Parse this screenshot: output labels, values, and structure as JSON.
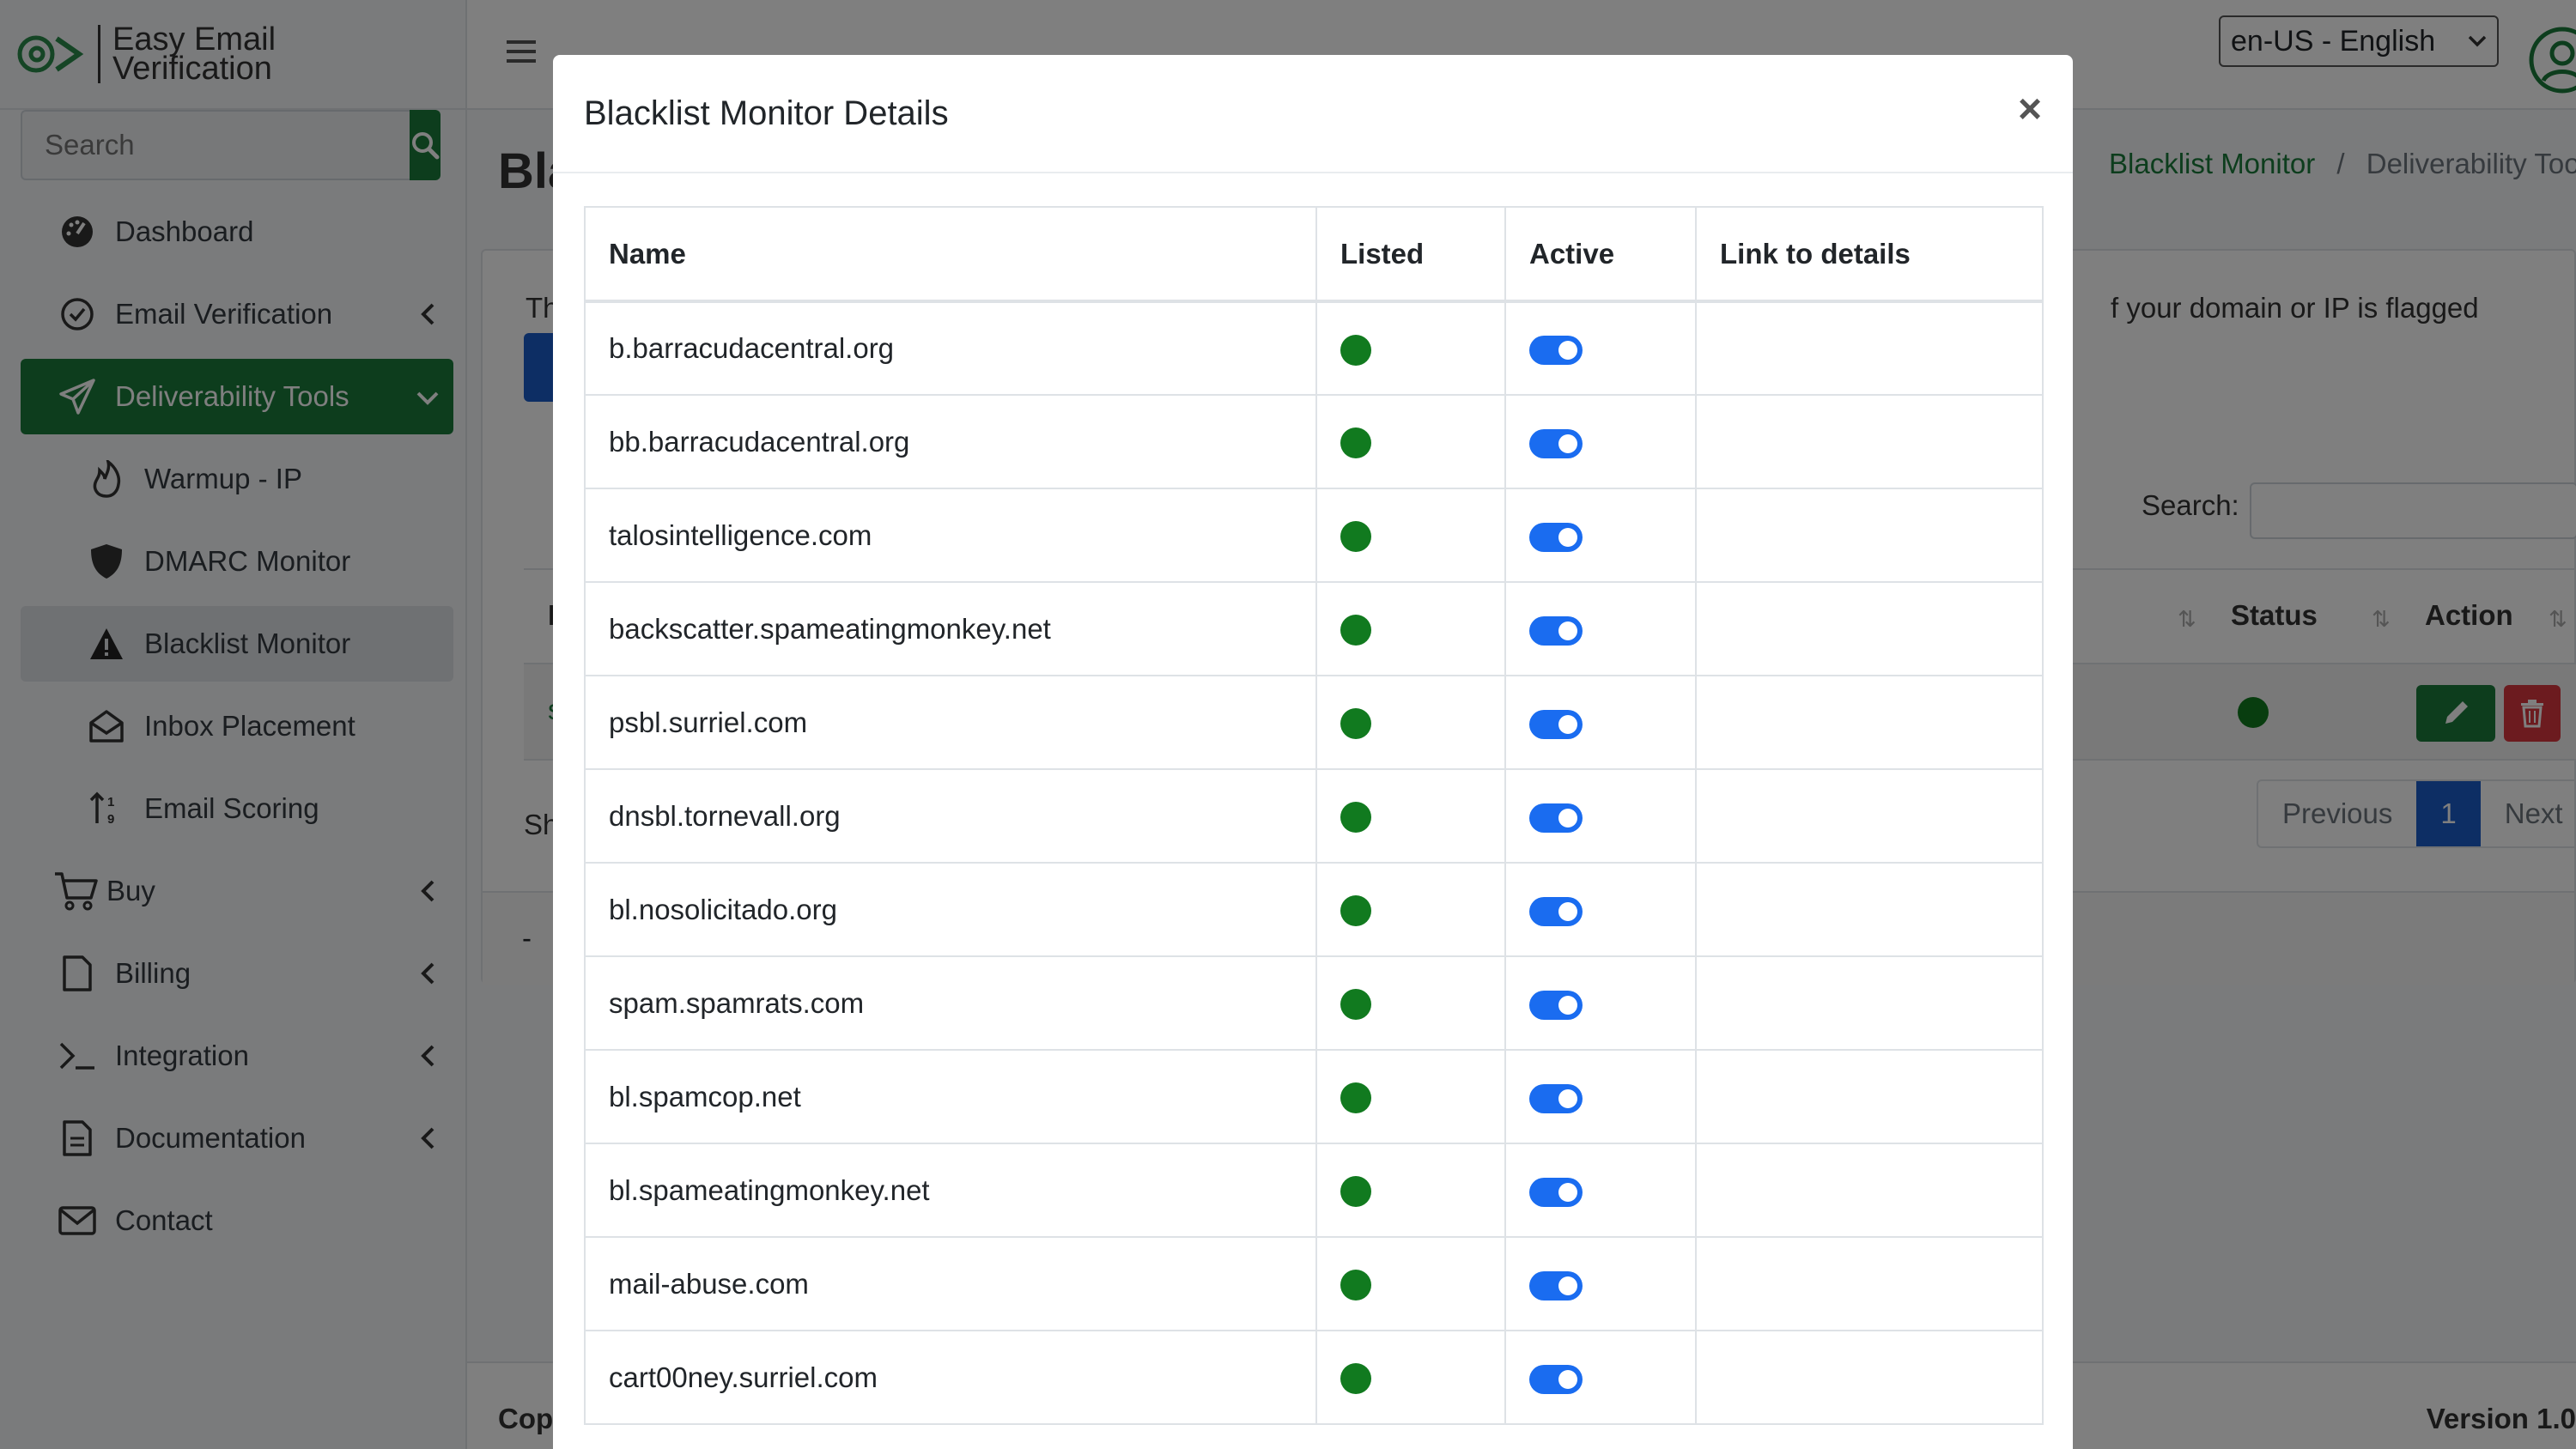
{
  "brand": {
    "line1": "Easy Email",
    "line2": "Verification"
  },
  "sidebar": {
    "search_placeholder": "Search",
    "items": [
      {
        "label": "Dashboard"
      },
      {
        "label": "Email Verification"
      },
      {
        "label": "Deliverability Tools"
      },
      {
        "label": "Warmup - IP"
      },
      {
        "label": "DMARC Monitor"
      },
      {
        "label": "Blacklist Monitor"
      },
      {
        "label": "Inbox Placement"
      },
      {
        "label": "Email Scoring"
      },
      {
        "label": "Buy"
      },
      {
        "label": "Billing"
      },
      {
        "label": "Integration"
      },
      {
        "label": "Documentation"
      },
      {
        "label": "Contact"
      }
    ]
  },
  "topbar": {
    "language": "en-US - English"
  },
  "page": {
    "title": "Bla",
    "breadcrumb_link": "Blacklist Monitor",
    "breadcrumb_sep": "/",
    "breadcrumb_current": "Deliverability Too",
    "intro_start": "Th",
    "intro_end": "f your domain or IP is flagged",
    "search_label": "Search:",
    "table": {
      "col_partial": "I",
      "col_status": "Status",
      "col_action": "Action",
      "row_partial": "s"
    },
    "show_text": "Sh",
    "foot_text": "-",
    "pager": {
      "previous": "Previous",
      "current": "1",
      "next": "Next"
    }
  },
  "footer": {
    "copy": "Cop",
    "version": "Version 1.0"
  },
  "modal": {
    "title": "Blacklist Monitor Details",
    "close": "×",
    "columns": {
      "name": "Name",
      "listed": "Listed",
      "active": "Active",
      "link": "Link to details"
    },
    "rows": [
      {
        "name": "b.barracudacentral.org",
        "listed": true,
        "active": true,
        "link": ""
      },
      {
        "name": "bb.barracudacentral.org",
        "listed": true,
        "active": true,
        "link": ""
      },
      {
        "name": "talosintelligence.com",
        "listed": true,
        "active": true,
        "link": ""
      },
      {
        "name": "backscatter.spameatingmonkey.net",
        "listed": true,
        "active": true,
        "link": ""
      },
      {
        "name": "psbl.surriel.com",
        "listed": true,
        "active": true,
        "link": ""
      },
      {
        "name": "dnsbl.tornevall.org",
        "listed": true,
        "active": true,
        "link": ""
      },
      {
        "name": "bl.nosolicitado.org",
        "listed": true,
        "active": true,
        "link": ""
      },
      {
        "name": "spam.spamrats.com",
        "listed": true,
        "active": true,
        "link": ""
      },
      {
        "name": "bl.spamcop.net",
        "listed": true,
        "active": true,
        "link": ""
      },
      {
        "name": "bl.spameatingmonkey.net",
        "listed": true,
        "active": true,
        "link": ""
      },
      {
        "name": "mail-abuse.com",
        "listed": true,
        "active": true,
        "link": ""
      },
      {
        "name": "cart00ney.surriel.com",
        "listed": true,
        "active": true,
        "link": ""
      }
    ]
  },
  "colors": {
    "brand_green": "#1a7a3a",
    "status_green": "#117a1f",
    "primary_blue": "#1a5dc9",
    "toggle_blue": "#1a6cf0",
    "danger_red": "#d9363e"
  },
  "icons": [
    "search-icon",
    "dashboard-icon",
    "check-circle-icon",
    "paper-plane-icon",
    "fire-icon",
    "shield-icon",
    "warning-icon",
    "envelope-open-icon",
    "sort-icon",
    "cart-icon",
    "file-icon",
    "terminal-icon",
    "document-icon",
    "envelope-icon",
    "chevron-left-icon",
    "chevron-down-icon",
    "hamburger-icon",
    "user-icon",
    "pencil-icon",
    "trash-icon",
    "close-icon"
  ]
}
